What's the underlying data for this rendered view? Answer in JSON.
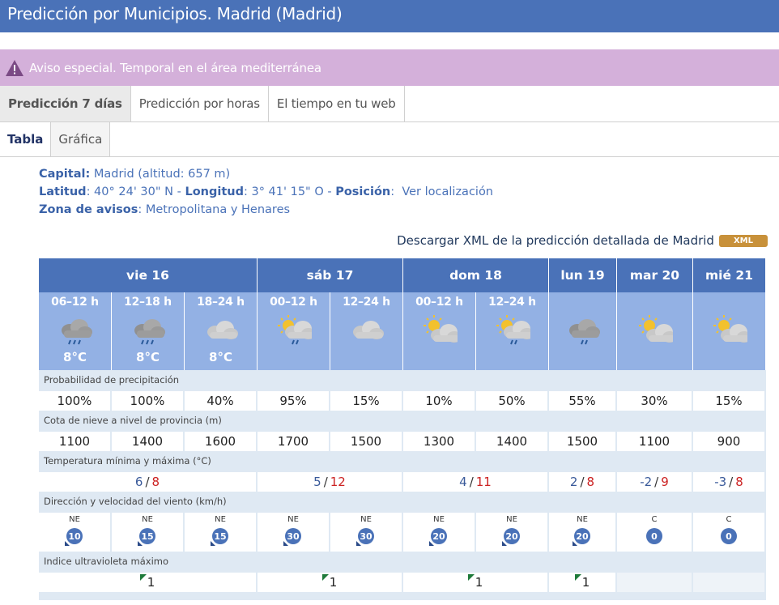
{
  "header": {
    "title": "Predicción por Municipios. Madrid (Madrid)"
  },
  "alert": {
    "text": "Aviso especial. Temporal en el área mediterránea",
    "icon": "warning-icon",
    "color": "#d4b0da"
  },
  "tabs_main": [
    {
      "label": "Predicción 7 días",
      "active": true
    },
    {
      "label": "Predicción por horas",
      "active": false
    },
    {
      "label": "El tiempo en tu web",
      "active": false
    }
  ],
  "tabs_sub": [
    {
      "label": "Tabla",
      "active": true
    },
    {
      "label": "Gráfica",
      "active": false
    }
  ],
  "location": {
    "capital_label": "Capital:",
    "capital_value": " Madrid (altitud: 657 m)",
    "latitud_label": "Latitud",
    "latitud_value": ": 40° 24' 30\" N - ",
    "longitud_label": "Longitud",
    "longitud_value": ": 3° 41' 15\" O - ",
    "posicion_label": "Posición",
    "posicion_value": ":",
    "ver_link": "Ver localización",
    "zona_label": "Zona de avisos",
    "zona_value": ": Metropolitana y Henares"
  },
  "download": {
    "text": "Descargar XML de la predicción detallada de Madrid",
    "badge": "XML"
  },
  "days": [
    "vie 16",
    "sáb 17",
    "dom 18",
    "lun 19",
    "mar 20",
    "mié 21"
  ],
  "periods": [
    {
      "time": "06–12 h",
      "temp": "8°C",
      "icon": "cloud-rain-icon"
    },
    {
      "time": "12–18 h",
      "temp": "8°C",
      "icon": "cloud-rain-icon"
    },
    {
      "time": "18–24 h",
      "temp": "8°C",
      "icon": "cloud-icon"
    },
    {
      "time": "00–12 h",
      "temp": "",
      "icon": "sun-cloud-rain-icon"
    },
    {
      "time": "12–24 h",
      "temp": "",
      "icon": "cloud-icon"
    },
    {
      "time": "00–12 h",
      "temp": "",
      "icon": "sun-cloud-icon"
    },
    {
      "time": "12–24 h",
      "temp": "",
      "icon": "sun-cloud-rain-icon"
    },
    {
      "time": "",
      "temp": "",
      "icon": "cloud-drizzle-icon"
    },
    {
      "time": "",
      "temp": "",
      "icon": "sun-cloud-icon"
    },
    {
      "time": "",
      "temp": "",
      "icon": "sun-cloud-icon"
    }
  ],
  "labels": {
    "precip": "Probabilidad de precipitación",
    "snow": "Cota de nieve a nivel de provincia (m)",
    "temp": "Temperatura mínima y máxima (°C)",
    "wind": "Dirección y velocidad del viento (km/h)",
    "uv": "Indice ultravioleta máximo"
  },
  "precip": [
    "100%",
    "100%",
    "40%",
    "95%",
    "15%",
    "10%",
    "50%",
    "55%",
    "30%",
    "15%"
  ],
  "snow": [
    "1100",
    "1400",
    "1600",
    "1700",
    "1500",
    "1300",
    "1400",
    "1500",
    "1100",
    "900"
  ],
  "temps": [
    {
      "min": "6",
      "max": "8"
    },
    {
      "min": "5",
      "max": "12"
    },
    {
      "min": "4",
      "max": "11"
    },
    {
      "min": "2",
      "max": "8"
    },
    {
      "min": "-2",
      "max": "9"
    },
    {
      "min": "-3",
      "max": "8"
    }
  ],
  "wind": [
    {
      "dir": "NE",
      "speed": "10"
    },
    {
      "dir": "NE",
      "speed": "15"
    },
    {
      "dir": "NE",
      "speed": "15"
    },
    {
      "dir": "NE",
      "speed": "30"
    },
    {
      "dir": "NE",
      "speed": "30"
    },
    {
      "dir": "NE",
      "speed": "20"
    },
    {
      "dir": "NE",
      "speed": "20"
    },
    {
      "dir": "NE",
      "speed": "20"
    },
    {
      "dir": "C",
      "speed": "0"
    },
    {
      "dir": "C",
      "speed": "0"
    }
  ],
  "uv": [
    "1",
    "1",
    "1",
    "1",
    "",
    ""
  ],
  "colors": {
    "header": "#4a72b8",
    "period": "#93b1e4",
    "row_label": "#dfe9f3",
    "max_temp": "#cc2222",
    "xml_badge": "#c8913a"
  }
}
